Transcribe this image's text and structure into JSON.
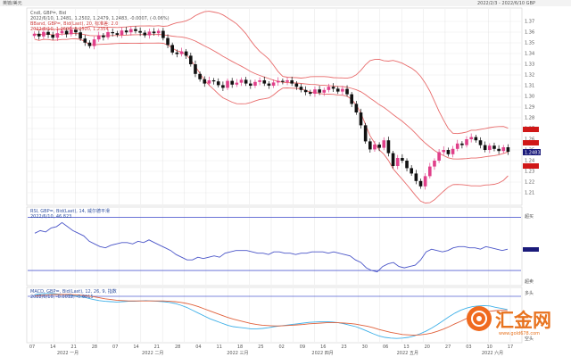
{
  "window": {
    "title": "英镑/美元",
    "header_right": "2022/2/3 - 2022/6/10 GBP"
  },
  "price_panel": {
    "line1": "Cndl, GBP=, Bid",
    "line2": "2022/6/10, 1.2481, 1.2502, 1.2479, 1.2483, -0.0007, (-0.06%)",
    "line3": "BBand, GBP=, Bid(Last), 20, 标准差: 2.0",
    "line4": "2022/6/10, 1.2606, 1.2520, 1.2354",
    "last_price_label": "1.2483"
  },
  "rsi_panel": {
    "line1": "RSI, GBP=, Bid(Last), 14, 威尔德平滑",
    "line2": "2022/6/10, 46.823",
    "axis_top": "超买",
    "axis_bottom": "超卖"
  },
  "macd_panel": {
    "line1": "MACD, GBP=, Bid(Last), 12, 26, 9, 指数",
    "line2": "2022/6/10, -0.0012, -0.0015",
    "axis_top": "多头",
    "axis_bottom": "空头"
  },
  "x_axis": {
    "day_labels": [
      "07",
      "14",
      "21",
      "28",
      "07",
      "14",
      "21",
      "28",
      "04",
      "11",
      "18",
      "25",
      "02",
      "09",
      "16",
      "23",
      "30",
      "06",
      "13",
      "20",
      "27",
      "03",
      "10",
      "17"
    ],
    "month_labels": [
      "2022 一月",
      "2022 二月",
      "2022 三月",
      "2022 四月",
      "2022 五月",
      "2022 六月"
    ]
  },
  "watermark": {
    "brand": "汇金网",
    "url": "www.gold678.com"
  },
  "colors": {
    "up_candle": "#e0408a",
    "down_candle": "#111111",
    "bollinger": "#e86b6b",
    "rsi_line": "#4a55c8",
    "macd_line": "#3fb0e8",
    "signal_line": "#e0603a",
    "grid": "#e4e4e4",
    "level_marker": "#d01818",
    "price_marker": "#1a1a7a"
  },
  "chart_data": [
    {
      "type": "candlestick",
      "series": [
        {
          "name": "GBP=",
          "values": [
            1.3585,
            1.356,
            1.3602,
            1.3575,
            1.3548,
            1.359,
            1.3612,
            1.358,
            1.3625,
            1.3598,
            1.354,
            1.3502,
            1.347,
            1.3532,
            1.357,
            1.3552,
            1.36,
            1.359,
            1.3575,
            1.3615,
            1.3598,
            1.3628,
            1.361,
            1.3595,
            1.357,
            1.3605,
            1.359,
            1.3612,
            1.3545,
            1.348,
            1.341,
            1.3395,
            1.342,
            1.338,
            1.33,
            1.321,
            1.316,
            1.312,
            1.315,
            1.314,
            1.3105,
            1.308,
            1.3145,
            1.311,
            1.3128,
            1.3155,
            1.312,
            1.31,
            1.3135,
            1.315,
            1.312,
            1.31,
            1.313,
            1.3145,
            1.3135,
            1.315,
            1.312,
            1.309,
            1.306,
            1.304,
            1.3025,
            1.3065,
            1.3035,
            1.306,
            1.309,
            1.3072,
            1.3045,
            1.307,
            1.302,
            1.293,
            1.285,
            1.273,
            1.258,
            1.2505,
            1.255,
            1.252,
            1.259,
            1.247,
            1.235,
            1.2425,
            1.24,
            1.233,
            1.228,
            1.221,
            1.216,
            1.2255,
            1.2345,
            1.24,
            1.248,
            1.25,
            1.246,
            1.251,
            1.256,
            1.2545,
            1.26,
            1.262,
            1.259,
            1.2545,
            1.25,
            1.254,
            1.251,
            1.249,
            1.2525,
            1.2483
          ]
        }
      ],
      "ylim": [
        1.2,
        1.38
      ]
    },
    {
      "type": "line",
      "title": "RSI",
      "series": [
        {
          "name": "RSI",
          "values": [
            58,
            60,
            59,
            62,
            63,
            66,
            63,
            60,
            58,
            56,
            52,
            50,
            48,
            47,
            49,
            50,
            51,
            51,
            50,
            52,
            51,
            53,
            51,
            49,
            47,
            45,
            42,
            40,
            38,
            38,
            40,
            39,
            40,
            41,
            40,
            43,
            44,
            45,
            45,
            45,
            44,
            43,
            43,
            42,
            44,
            44,
            43,
            43,
            42,
            43,
            43,
            44,
            44,
            44,
            43,
            44,
            43,
            42,
            41,
            38,
            36,
            32,
            30,
            29,
            33,
            35,
            36,
            33,
            32,
            33,
            34,
            38,
            44,
            46,
            45,
            44,
            45,
            47,
            48,
            48,
            47,
            47,
            46,
            48,
            47,
            46,
            45,
            46
          ]
        }
      ],
      "ylim": [
        20,
        75
      ],
      "reference_levels": [
        70,
        30
      ]
    },
    {
      "type": "line",
      "title": "MACD",
      "series": [
        {
          "name": "MACD",
          "values": [
            0.003,
            0.0032,
            0.0033,
            0.0033,
            0.0031,
            0.003,
            0.0028,
            0.0026,
            0.0024,
            0.002,
            0.0016,
            0.0013,
            0.0011,
            0.001,
            0.0009,
            0.001,
            0.0011,
            0.0011,
            0.0012,
            0.0013,
            0.0012,
            0.0011,
            0.001,
            0.0008,
            0.0005,
            0.0,
            -0.0006,
            -0.0014,
            -0.0022,
            -0.003,
            -0.0038,
            -0.0044,
            -0.005,
            -0.0056,
            -0.006,
            -0.0062,
            -0.0064,
            -0.0066,
            -0.0066,
            -0.0065,
            -0.0063,
            -0.006,
            -0.0058,
            -0.0056,
            -0.0054,
            -0.0052,
            -0.005,
            -0.0048,
            -0.0047,
            -0.0046,
            -0.0046,
            -0.0047,
            -0.0049,
            -0.0052,
            -0.0056,
            -0.006,
            -0.0066,
            -0.0073,
            -0.008,
            -0.0086,
            -0.009,
            -0.0092,
            -0.0093,
            -0.0092,
            -0.009,
            -0.0086,
            -0.008,
            -0.0073,
            -0.0064,
            -0.0054,
            -0.0043,
            -0.0032,
            -0.0022,
            -0.0014,
            -0.0008,
            -0.0004,
            -0.0002,
            -0.0001,
            -0.0002,
            -0.0006,
            -0.0009,
            -0.0012
          ]
        },
        {
          "name": "Signal",
          "values": [
            0.0026,
            0.0028,
            0.0029,
            0.003,
            0.003,
            0.003,
            0.003,
            0.0029,
            0.0028,
            0.0026,
            0.0024,
            0.0021,
            0.0018,
            0.0016,
            0.0014,
            0.0013,
            0.0012,
            0.0012,
            0.0012,
            0.0012,
            0.0012,
            0.0012,
            0.0012,
            0.0011,
            0.001,
            0.0008,
            0.0005,
            0.0001,
            -0.0004,
            -0.001,
            -0.0016,
            -0.0022,
            -0.0028,
            -0.0034,
            -0.0039,
            -0.0043,
            -0.0047,
            -0.0051,
            -0.0054,
            -0.0056,
            -0.0057,
            -0.0058,
            -0.0058,
            -0.0057,
            -0.0056,
            -0.0055,
            -0.0054,
            -0.0052,
            -0.0051,
            -0.005,
            -0.0049,
            -0.0049,
            -0.0049,
            -0.005,
            -0.0051,
            -0.0053,
            -0.0056,
            -0.0059,
            -0.0063,
            -0.0068,
            -0.0072,
            -0.0076,
            -0.0079,
            -0.0082,
            -0.0083,
            -0.0084,
            -0.0083,
            -0.0081,
            -0.0078,
            -0.0073,
            -0.0067,
            -0.006,
            -0.0052,
            -0.0045,
            -0.0037,
            -0.0031,
            -0.0025,
            -0.002,
            -0.0017,
            -0.0015,
            -0.0014,
            -0.0015
          ]
        }
      ],
      "ylim": [
        -0.01,
        0.004
      ]
    }
  ]
}
